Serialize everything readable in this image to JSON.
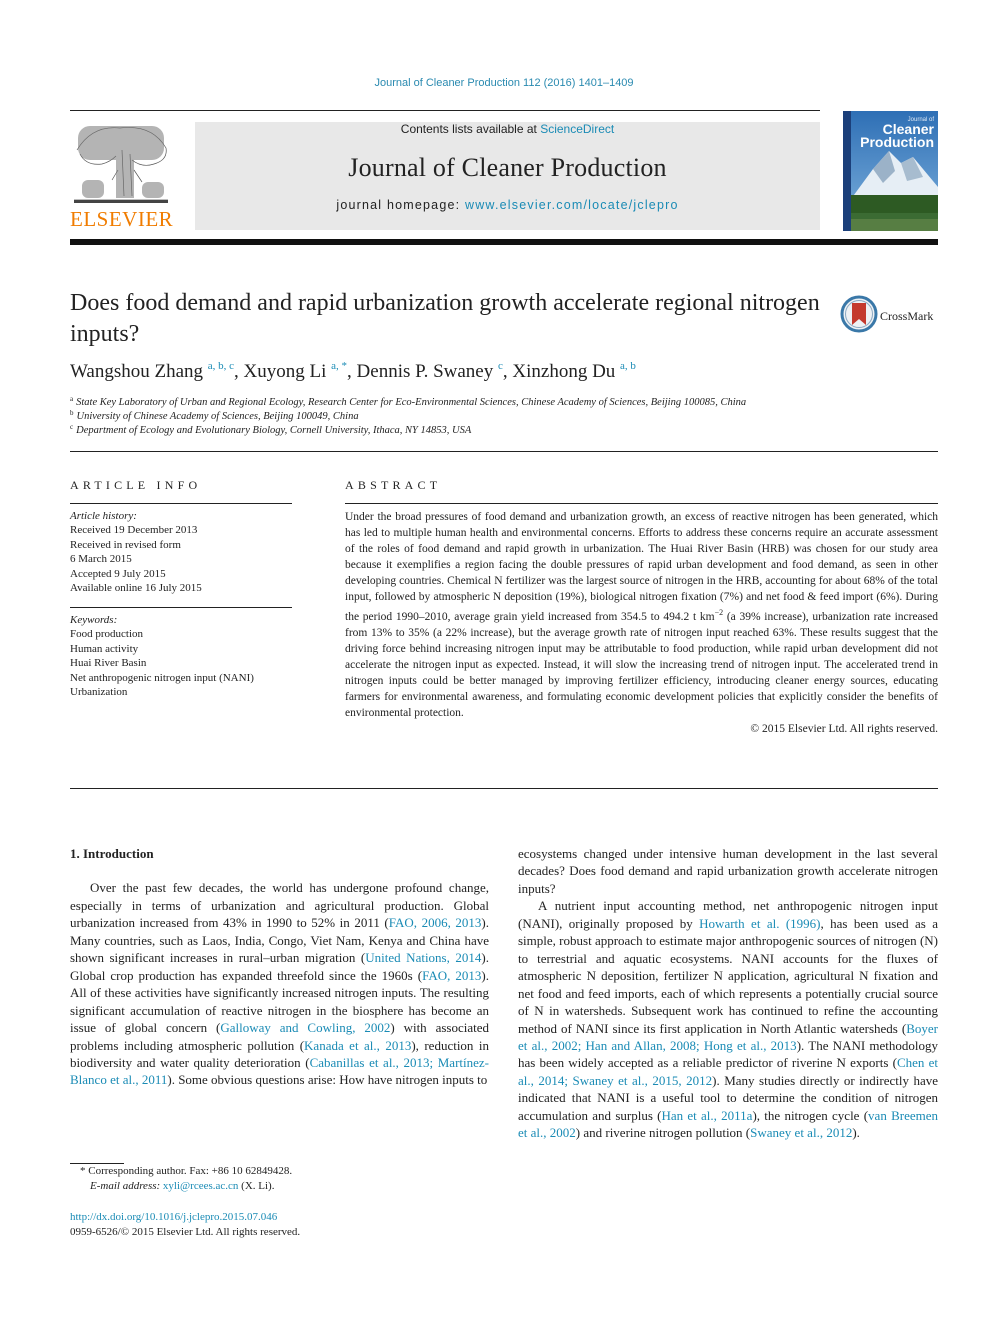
{
  "header": {
    "journal_ref": "Journal of Cleaner Production 112 (2016) 1401–1409",
    "contents_prefix": "Contents lists available at ",
    "contents_link": "ScienceDirect",
    "journal_name": "Journal of Cleaner Production",
    "homepage_prefix": "journal homepage: ",
    "homepage_link": "www.elsevier.com/locate/jclepro",
    "publisher_logo": "ELSEVIER",
    "cover": {
      "small_title": "Journal of",
      "title_line1": "Cleaner",
      "title_line2": "Production"
    },
    "accent_color": "#1a8bb5",
    "publisher_color": "#f07c00"
  },
  "article": {
    "title": "Does food demand and rapid urbanization growth accelerate regional nitrogen inputs?",
    "crossmark_label": "CrossMark",
    "authors": [
      {
        "name": "Wangshou Zhang",
        "sup": "a, b, c",
        "sep": ", "
      },
      {
        "name": "Xuyong Li",
        "sup": "a, *",
        "sep": ", "
      },
      {
        "name": "Dennis P. Swaney",
        "sup": "c",
        "sep": ", "
      },
      {
        "name": "Xinzhong Du",
        "sup": "a, b",
        "sep": ""
      }
    ],
    "affiliations": [
      {
        "key": "a",
        "text": "State Key Laboratory of Urban and Regional Ecology, Research Center for Eco-Environmental Sciences, Chinese Academy of Sciences, Beijing 100085, China"
      },
      {
        "key": "b",
        "text": "University of Chinese Academy of Sciences, Beijing 100049, China"
      },
      {
        "key": "c",
        "text": "Department of Ecology and Evolutionary Biology, Cornell University, Ithaca, NY 14853, USA"
      }
    ]
  },
  "article_info": {
    "label": "ARTICLE INFO",
    "history_heading": "Article history:",
    "history": [
      "Received 19 December 2013",
      "Received in revised form",
      "6 March 2015",
      "Accepted 9 July 2015",
      "Available online 16 July 2015"
    ],
    "keywords_heading": "Keywords:",
    "keywords": [
      "Food production",
      "Human activity",
      "Huai River Basin",
      "Net anthropogenic nitrogen input (NANI)",
      "Urbanization"
    ]
  },
  "abstract": {
    "label": "ABSTRACT",
    "text_part1": "Under the broad pressures of food demand and urbanization growth, an excess of reactive nitrogen has been generated, which has led to multiple human health and environmental concerns. Efforts to address these concerns require an accurate assessment of the roles of food demand and rapid growth in urbanization. The Huai River Basin (HRB) was chosen for our study area because it exemplifies a region facing the double pressures of rapid urban development and food demand, as seen in other developing countries. Chemical N fertilizer was the largest source of nitrogen in the HRB, accounting for about 68% of the total input, followed by atmospheric N deposition (19%), biological nitrogen fixation (7%) and net food & feed import (6%). During the period 1990–2010, average grain yield increased from 354.5 to 494.2 t km",
    "superscript": "−2",
    "text_part2": " (a 39% increase), urbanization rate increased from 13% to 35% (a 22% increase), but the average growth rate of nitrogen input reached 63%. These results suggest that the driving force behind increasing nitrogen input may be attributable to food production, while rapid urban development did not accelerate the nitrogen input as expected. Instead, it will slow the increasing trend of nitrogen input. The accelerated trend in nitrogen inputs could be better managed by improving fertilizer efficiency, introducing cleaner energy sources, educating farmers for environmental awareness, and formulating economic development policies that explicitly consider the benefits of environmental protection.",
    "copyright": "© 2015 Elsevier Ltd. All rights reserved."
  },
  "introduction": {
    "heading": "1.  Introduction",
    "left_para": [
      {
        "t": "Over the past few decades, the world has undergone profound change, especially in terms of urbanization and agricultural production. Global urbanization increased from 43% in 1990 to 52% in 2011 ("
      },
      {
        "l": "FAO, 2006, 2013"
      },
      {
        "t": "). Many countries, such as Laos, India, Congo, Viet Nam, Kenya and China have shown significant increases in rural–urban migration ("
      },
      {
        "l": "United Nations, 2014"
      },
      {
        "t": "). Global crop production has expanded threefold since the 1960s ("
      },
      {
        "l": "FAO, 2013"
      },
      {
        "t": "). All of these activities have significantly increased nitrogen inputs. The resulting significant accumulation of reactive nitrogen in the biosphere has become an issue of global concern ("
      },
      {
        "l": "Galloway and Cowling, 2002"
      },
      {
        "t": ") with associated problems including atmospheric pollution ("
      },
      {
        "l": "Kanada et al., 2013"
      },
      {
        "t": "), reduction in biodiversity and water quality deterioration ("
      },
      {
        "l": "Cabanillas et al., 2013; Martínez-Blanco et al., 2011"
      },
      {
        "t": "). Some obvious questions arise: How have nitrogen inputs to"
      }
    ],
    "right_para1": "ecosystems changed under intensive human development in the last several decades? Does food demand and rapid urbanization growth accelerate nitrogen inputs?",
    "right_para2": [
      {
        "t": "A nutrient input accounting method, net anthropogenic nitrogen input (NANI), originally proposed by "
      },
      {
        "l": "Howarth et al. (1996)"
      },
      {
        "t": ", has been used as a simple, robust approach to estimate major anthropogenic sources of nitrogen (N) to terrestrial and aquatic ecosystems. NANI accounts for the fluxes of atmospheric N deposition, fertilizer N application, agricultural N fixation and net food and feed imports, each of which represents a potentially crucial source of N in watersheds. Subsequent work has continued to refine the accounting method of NANI since its first application in North Atlantic watersheds ("
      },
      {
        "l": "Boyer et al., 2002; Han and Allan, 2008; Hong et al., 2013"
      },
      {
        "t": "). The NANI methodology has been widely accepted as a reliable predictor of riverine N exports ("
      },
      {
        "l": "Chen et al., 2014; Swaney et al., 2015, 2012"
      },
      {
        "t": "). Many studies directly or indirectly have indicated that NANI is a useful tool to determine the condition of nitrogen accumulation and surplus ("
      },
      {
        "l": "Han et al., 2011a"
      },
      {
        "t": "), the nitrogen cycle ("
      },
      {
        "l": "van Breemen et al., 2002"
      },
      {
        "t": ") and riverine nitrogen pollution ("
      },
      {
        "l": "Swaney et al., 2012"
      },
      {
        "t": ")."
      }
    ]
  },
  "footnotes": {
    "corresponding": "*  Corresponding author. Fax: +86 10 62849428.",
    "email_label": "E-mail address: ",
    "email": "xyli@rcees.ac.cn",
    "email_suffix": " (X. Li).",
    "doi": "http://dx.doi.org/10.1016/j.jclepro.2015.07.046",
    "issn": "0959-6526/© 2015 Elsevier Ltd. All rights reserved."
  }
}
